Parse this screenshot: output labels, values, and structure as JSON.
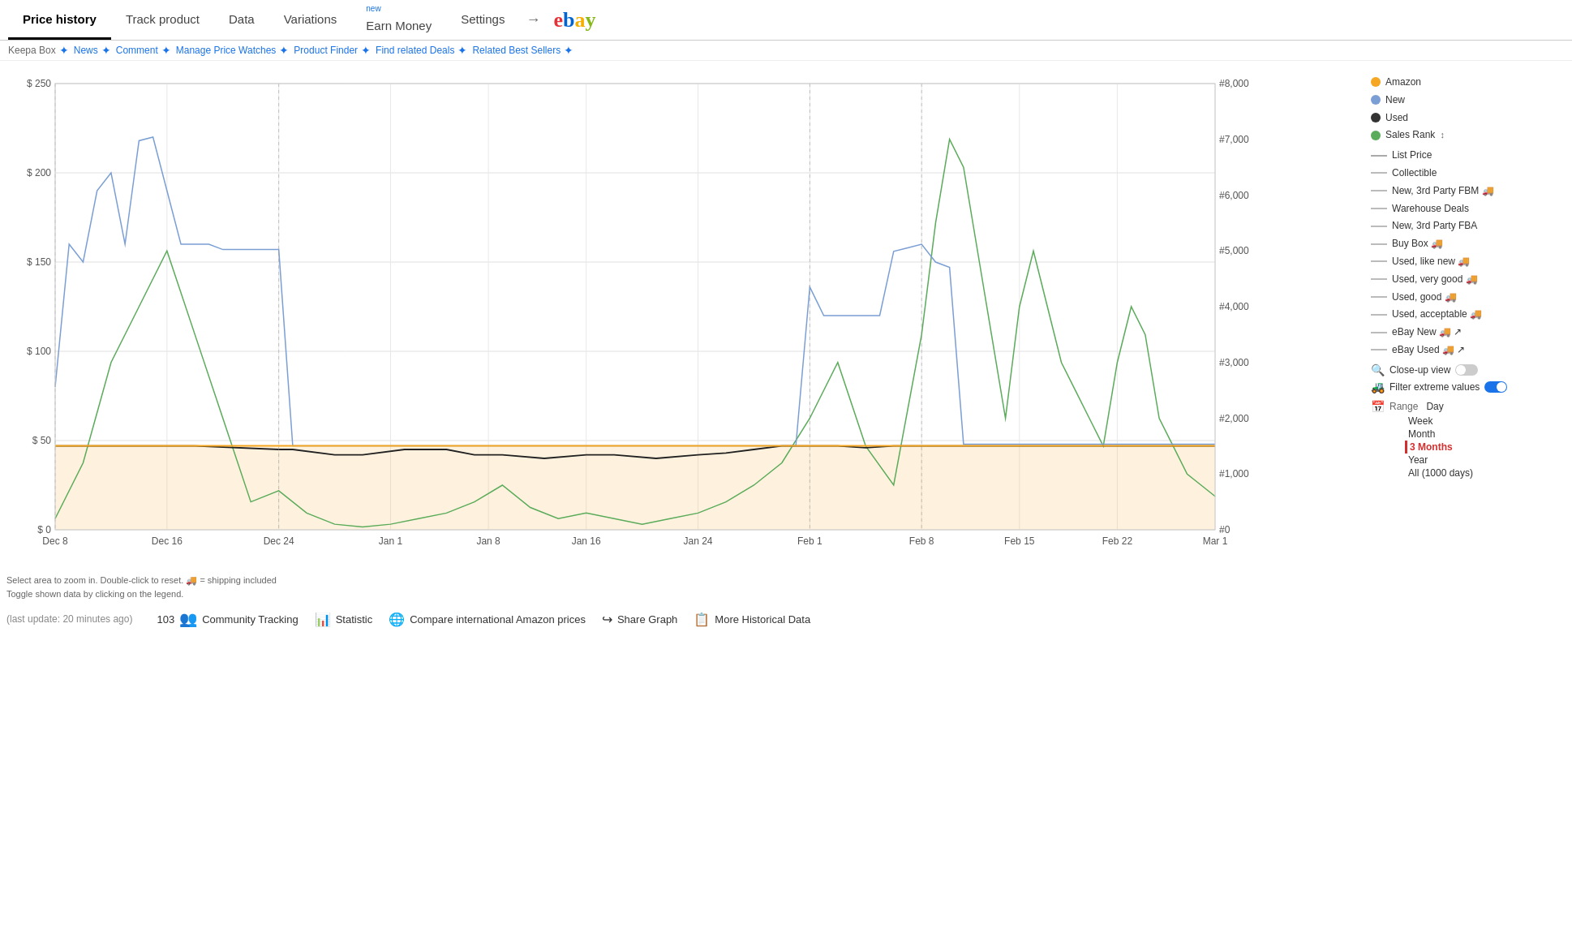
{
  "nav": {
    "tabs": [
      {
        "label": "Price history",
        "active": true
      },
      {
        "label": "Track product",
        "active": false
      },
      {
        "label": "Data",
        "active": false
      },
      {
        "label": "Variations",
        "active": false
      },
      {
        "label": "Earn Money",
        "active": false,
        "badge": "new"
      },
      {
        "label": "Settings",
        "active": false
      }
    ],
    "ebay_label": "ebay"
  },
  "secondary_nav": {
    "items": [
      {
        "label": "Keepa Box",
        "color": "gray"
      },
      {
        "label": "News",
        "color": "blue"
      },
      {
        "label": "Comment",
        "color": "blue"
      },
      {
        "label": "Manage Price Watches",
        "color": "blue"
      },
      {
        "label": "Product Finder",
        "color": "blue"
      },
      {
        "label": "Find related Deals",
        "color": "blue"
      },
      {
        "label": "Related Best Sellers",
        "color": "blue"
      }
    ]
  },
  "legend": {
    "items": [
      {
        "type": "dot",
        "color": "#f5a623",
        "label": "Amazon"
      },
      {
        "type": "dot",
        "color": "#7b9fd4",
        "label": "New"
      },
      {
        "type": "dot",
        "color": "#333333",
        "label": "Used"
      },
      {
        "type": "dot",
        "color": "#5aab5a",
        "label": "Sales Rank"
      },
      {
        "type": "line",
        "color": "#aaa",
        "label": "List Price"
      },
      {
        "type": "line",
        "color": "#bbb",
        "label": "Collectible"
      },
      {
        "type": "line",
        "color": "#bbb",
        "label": "New, 3rd Party FBM 🚚"
      },
      {
        "type": "line",
        "color": "#bbb",
        "label": "Warehouse Deals"
      },
      {
        "type": "line",
        "color": "#bbb",
        "label": "New, 3rd Party FBA"
      },
      {
        "type": "line",
        "color": "#bbb",
        "label": "Buy Box 🚚"
      },
      {
        "type": "line",
        "color": "#bbb",
        "label": "Used, like new 🚚"
      },
      {
        "type": "line",
        "color": "#bbb",
        "label": "Used, very good 🚚"
      },
      {
        "type": "line",
        "color": "#bbb",
        "label": "Used, good 🚚"
      },
      {
        "type": "line",
        "color": "#bbb",
        "label": "Used, acceptable 🚚"
      },
      {
        "type": "line",
        "color": "#bbb",
        "label": "eBay New 🚚 ↗"
      },
      {
        "type": "line",
        "color": "#bbb",
        "label": "eBay Used 🚚 ↗"
      }
    ],
    "controls": {
      "closeup_label": "Close-up view",
      "filter_label": "Filter extreme values",
      "range_label": "Range",
      "range_options": [
        "Day",
        "Week",
        "Month",
        "3 Months",
        "Year",
        "All (1000 days)"
      ],
      "range_active": "3 Months"
    }
  },
  "chart": {
    "y_labels": [
      "$ 0",
      "$ 50",
      "$ 100",
      "$ 150",
      "$ 200",
      "$ 250"
    ],
    "y2_labels": [
      "#0",
      "#1,000",
      "#2,000",
      "#3,000",
      "#4,000",
      "#5,000",
      "#6,000",
      "#7,000",
      "#8,000"
    ],
    "x_labels": [
      "Dec 8",
      "Dec 16",
      "Dec 24",
      "Jan 1",
      "Jan 8",
      "Jan 16",
      "Jan 24",
      "Feb 1",
      "Feb 8",
      "Feb 15",
      "Feb 22",
      "Mar 1"
    ]
  },
  "footer": {
    "last_update": "(last update: 20 minutes ago)",
    "community_count": "103",
    "community_label": "Community Tracking",
    "statistic_label": "Statistic",
    "compare_label": "Compare international Amazon prices",
    "share_label": "Share Graph",
    "historical_label": "More Historical Data"
  },
  "hints": {
    "line1": "Select area to zoom in. Double-click to reset.  🚚 = shipping included",
    "line2": "Toggle shown data by clicking on the legend."
  }
}
